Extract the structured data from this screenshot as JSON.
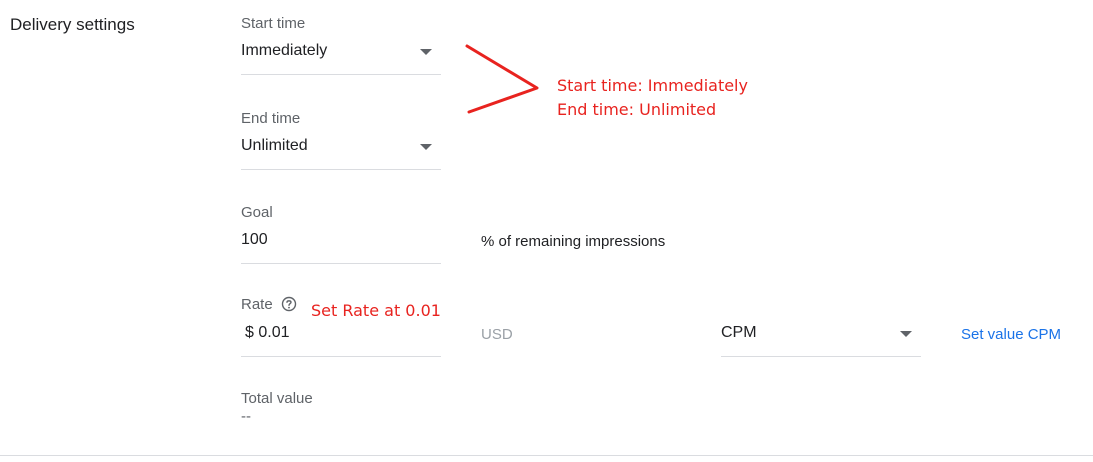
{
  "section": {
    "title": "Delivery settings"
  },
  "start_time": {
    "label": "Start time",
    "value": "Immediately"
  },
  "end_time": {
    "label": "End time",
    "value": "Unlimited"
  },
  "goal": {
    "label": "Goal",
    "value": "100",
    "suffix": "% of remaining impressions"
  },
  "rate": {
    "label": "Rate",
    "help_icon": "help-circle-icon",
    "value": "$ 0.01",
    "currency": "USD",
    "type_value": "CPM",
    "set_value_link": "Set value CPM"
  },
  "total_value": {
    "label": "Total value",
    "value": "--"
  },
  "annotations": {
    "start_time": "Start time: Immediately",
    "end_time": "End time: Unlimited",
    "rate": "Set Rate at 0.01",
    "color": "#e8231f"
  }
}
